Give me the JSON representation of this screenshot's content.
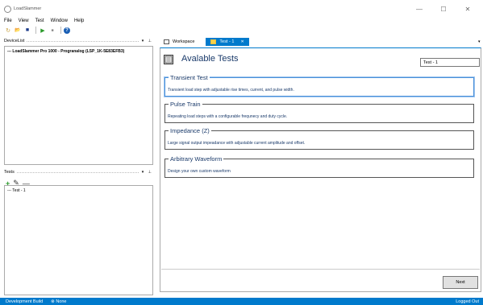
{
  "window": {
    "title": "LoadSlammer",
    "controls": {
      "minimize": "—",
      "maximize": "☐",
      "close": "✕"
    }
  },
  "menu": [
    "File",
    "View",
    "Test",
    "Window",
    "Help"
  ],
  "toolbar": {
    "buttons": [
      {
        "icon": "new-icon",
        "glyph": "↻"
      },
      {
        "icon": "open-icon",
        "glyph": "📂"
      },
      {
        "icon": "save-icon",
        "glyph": "■"
      },
      {
        "icon": "run-icon",
        "glyph": "▶"
      },
      {
        "icon": "stop-icon",
        "glyph": "■"
      },
      {
        "icon": "help-icon",
        "glyph": "?"
      }
    ]
  },
  "device_pane": {
    "title": "DeviceList",
    "controls": "▾ ⊥",
    "items": [
      "--- LoadSlammer Pro 1000 - Progranalog (LSP_1K-5E83EFB3)"
    ]
  },
  "tests_pane": {
    "title": "Tests",
    "controls": "▾ ⊥",
    "tools": {
      "add": "+",
      "edit": "✎",
      "remove": "—"
    },
    "items": [
      "--- Test - 1"
    ]
  },
  "tabs": [
    {
      "label": "Workspace"
    },
    {
      "label": "Test - 1",
      "close": "✕"
    }
  ],
  "page": {
    "title": "Avalable Tests",
    "test_name_value": "Test - 1"
  },
  "tests": [
    {
      "title": "Transient Test",
      "desc": "Transient load step with adjustable rise times, current, and pulse width."
    },
    {
      "title": "Pulse Train",
      "desc": "Repeating load steps with a configurable frequnecy and duty cycle."
    },
    {
      "title": "Impedance (Z)",
      "desc": "Large signal output impeadance with adjustable current amplitude and offset."
    },
    {
      "title": "Arbitrary Waveform",
      "desc": "Design your own custom waveform"
    }
  ],
  "next_label": "Next",
  "status": {
    "build": "Development Build",
    "connection": "None",
    "login": "Logged Out"
  },
  "colors": {
    "accent": "#007acc",
    "title_text": "#1a3a6a"
  }
}
